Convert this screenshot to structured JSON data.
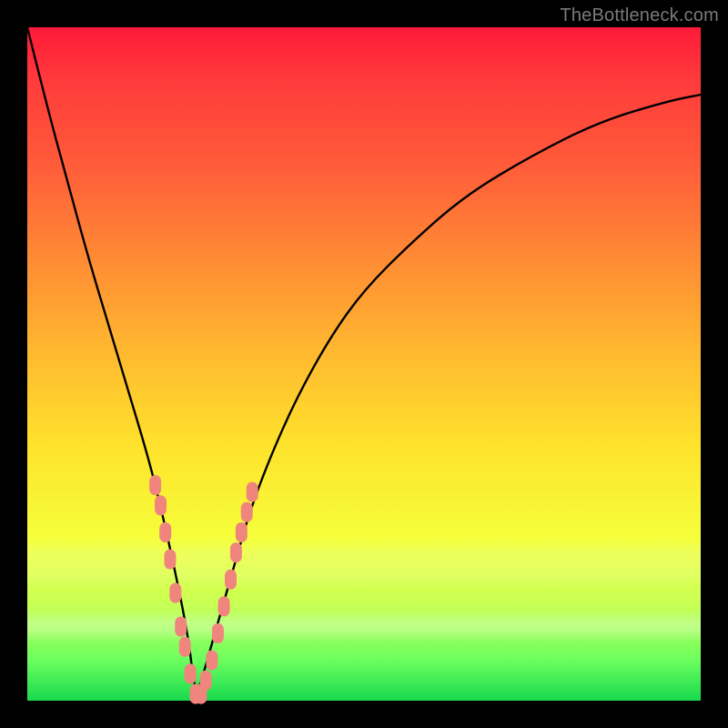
{
  "watermark": "TheBottleneck.com",
  "colors": {
    "bg_frame": "#000000",
    "gradient_top": "#ff1a3a",
    "gradient_bottom": "#17d94e",
    "curve_stroke": "#000000",
    "marker_fill": "#f0857e",
    "marker_stroke": "#c24a4a"
  },
  "chart_data": {
    "type": "line",
    "title": "",
    "xlabel": "",
    "ylabel": "",
    "x_range": [
      0,
      100
    ],
    "y_range": [
      0,
      100
    ],
    "notch_x": 25,
    "series": [
      {
        "name": "bottleneck-curve",
        "x": [
          0,
          3,
          6,
          9,
          12,
          15,
          18,
          20,
          22,
          24,
          25,
          27,
          29,
          31,
          33,
          36,
          40,
          45,
          50,
          57,
          65,
          75,
          85,
          95,
          100
        ],
        "y": [
          100,
          88,
          77,
          66,
          56,
          46,
          36,
          28,
          19,
          9,
          0,
          7,
          14,
          21,
          28,
          36,
          45,
          54,
          61,
          68,
          75,
          81,
          86,
          89,
          90
        ]
      }
    ],
    "markers": [
      {
        "x": 19.0,
        "y": 32
      },
      {
        "x": 19.8,
        "y": 29
      },
      {
        "x": 20.5,
        "y": 25
      },
      {
        "x": 21.2,
        "y": 21
      },
      {
        "x": 22.0,
        "y": 16
      },
      {
        "x": 22.8,
        "y": 11
      },
      {
        "x": 23.4,
        "y": 8
      },
      {
        "x": 24.2,
        "y": 4
      },
      {
        "x": 25.0,
        "y": 1
      },
      {
        "x": 25.8,
        "y": 1
      },
      {
        "x": 26.5,
        "y": 3
      },
      {
        "x": 27.4,
        "y": 6
      },
      {
        "x": 28.3,
        "y": 10
      },
      {
        "x": 29.2,
        "y": 14
      },
      {
        "x": 30.2,
        "y": 18
      },
      {
        "x": 31.0,
        "y": 22
      },
      {
        "x": 31.8,
        "y": 25
      },
      {
        "x": 32.6,
        "y": 28
      },
      {
        "x": 33.4,
        "y": 31
      }
    ]
  }
}
